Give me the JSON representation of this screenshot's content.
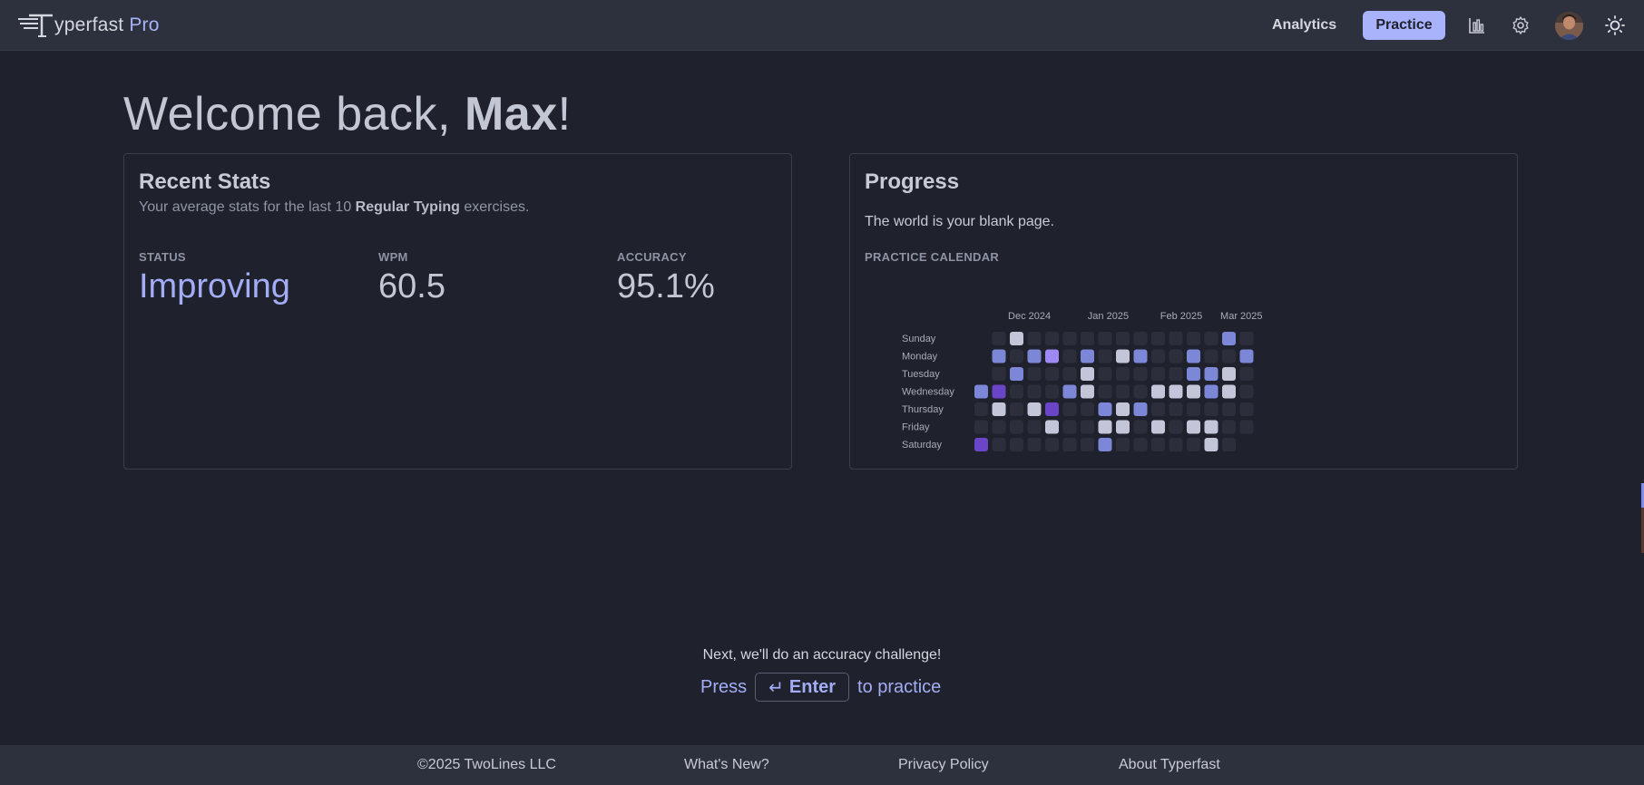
{
  "header": {
    "logo_letter": "T",
    "logo_text": "yperfast",
    "logo_pro": "Pro",
    "nav_analytics": "Analytics",
    "nav_practice": "Practice",
    "icons": [
      "bar-chart-icon",
      "gear-icon",
      "avatar",
      "sun-icon"
    ]
  },
  "welcome": {
    "prefix": "Welcome back, ",
    "name": "Max",
    "suffix": "!"
  },
  "recent_stats": {
    "title": "Recent Stats",
    "subtitle_prefix": "Your average stats for the last 10 ",
    "subtitle_bold": "Regular Typing",
    "subtitle_suffix": " exercises.",
    "status_label": "STATUS",
    "status_value": "Improving",
    "wpm_label": "WPM",
    "wpm_value": "60.5",
    "accuracy_label": "ACCURACY",
    "accuracy_value": "95.1%"
  },
  "progress": {
    "title": "Progress",
    "text": "The world is your blank page.",
    "calendar_label": "PRACTICE CALENDAR",
    "month_labels": [
      "Dec 2024",
      "Jan 2025",
      "Feb 2025",
      "Mar 2025"
    ],
    "day_labels": [
      "Sunday",
      "Monday",
      "Tuesday",
      "Wednesday",
      "Thursday",
      "Friday",
      "Saturday"
    ],
    "level_colors": [
      "#2c2f3b",
      "#c3c5d8",
      "#7c87d8",
      "#9f88f3",
      "#6a45c8"
    ],
    "grid": [
      [
        -1,
        0,
        1,
        0,
        0,
        0,
        0,
        0,
        0,
        0,
        0,
        0,
        0,
        0,
        2,
        0
      ],
      [
        -1,
        2,
        0,
        2,
        3,
        0,
        2,
        0,
        1,
        2,
        0,
        0,
        2,
        0,
        0,
        2
      ],
      [
        -1,
        0,
        2,
        0,
        0,
        0,
        1,
        0,
        0,
        0,
        0,
        0,
        2,
        2,
        1,
        0
      ],
      [
        2,
        4,
        0,
        0,
        0,
        2,
        1,
        0,
        0,
        0,
        1,
        1,
        1,
        2,
        1,
        0
      ],
      [
        0,
        1,
        0,
        1,
        4,
        0,
        0,
        2,
        1,
        2,
        0,
        0,
        0,
        0,
        0,
        0
      ],
      [
        0,
        0,
        0,
        0,
        1,
        0,
        0,
        1,
        1,
        0,
        1,
        0,
        1,
        1,
        0,
        0
      ],
      [
        4,
        0,
        0,
        0,
        0,
        0,
        0,
        2,
        0,
        0,
        0,
        0,
        0,
        1,
        0,
        -1
      ]
    ]
  },
  "prompt": {
    "next_text": "Next, we'll do an accuracy challenge!",
    "press": "Press",
    "enter_arrow": "↵",
    "enter_label": "Enter",
    "to_practice": "to practice"
  },
  "footer": {
    "copyright": "©2025 TwoLines LLC",
    "whats_new": "What's New?",
    "privacy": "Privacy Policy",
    "about": "About Typerfast"
  }
}
